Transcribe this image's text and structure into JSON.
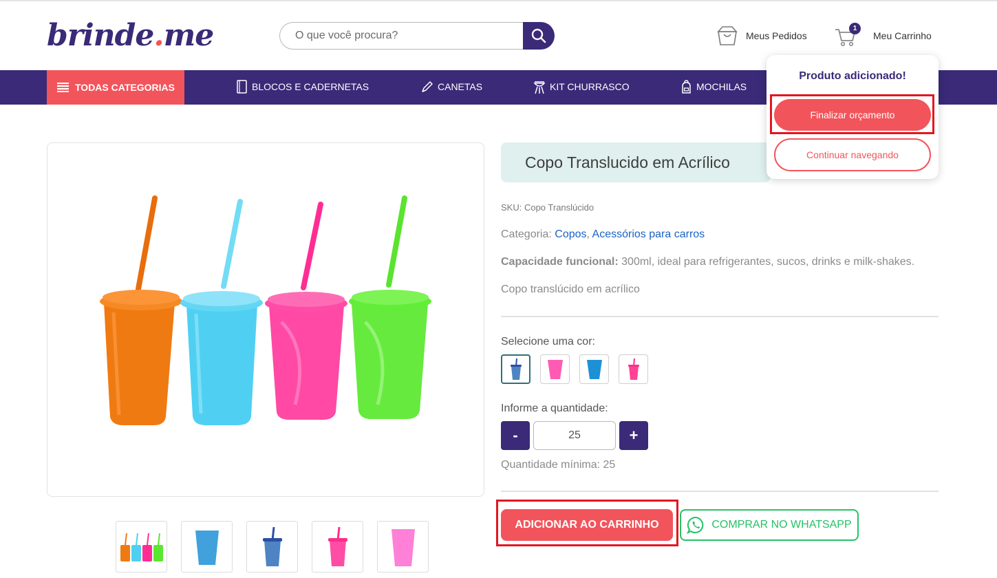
{
  "header": {
    "logo_main": "brinde",
    "logo_dot": ".",
    "logo_tail": "me",
    "search_placeholder": "O que você procura?",
    "orders_label": "Meus Pedidos",
    "cart_label": "Meu Carrinho",
    "cart_count": "1"
  },
  "nav": {
    "all_label": "TODAS CATEGORIAS",
    "items": [
      {
        "label": "BLOCOS E CADERNETAS",
        "icon": "notebook-icon"
      },
      {
        "label": "CANETAS",
        "icon": "pen-icon"
      },
      {
        "label": "KIT CHURRASCO",
        "icon": "grill-icon"
      },
      {
        "label": "MOCHILAS",
        "icon": "backpack-icon"
      }
    ]
  },
  "product": {
    "title": "Copo Translucido em Acrílico",
    "sku": "SKU: Copo Translúcido",
    "category_label": "Categoria:",
    "categories": [
      "Copos",
      "Acessórios para carros"
    ],
    "category_sep": ",",
    "capacity_label": "Capacidade funcional:",
    "capacity_value": " 300ml, ideal para refrigerantes, sucos, drinks e milk-shakes.",
    "description": "Copo translúcido em acrílico",
    "color_label": "Selecione uma cor:",
    "swatches": [
      {
        "color": "#2f6fb8",
        "icon": "cup-with-straw-icon"
      },
      {
        "color": "#ff3ea5",
        "icon": "cup-icon"
      },
      {
        "color": "#1e90d6",
        "icon": "cup-icon"
      },
      {
        "color": "#ff2d8a",
        "icon": "cup-with-straw-icon"
      }
    ],
    "quantity_label": "Informe a quantidade:",
    "quantity_minus": "-",
    "quantity_plus": "+",
    "quantity_value": "25",
    "min_quantity": "Quantidade mínima: 25",
    "add_to_cart": "ADICIONAR AO CARRINHO",
    "whatsapp": "COMPRAR NO WHATSAPP",
    "image_colors": [
      "#f07a12",
      "#4fd0f2",
      "#ff2d93",
      "#59e82e"
    ]
  },
  "popup": {
    "title": "Produto adicionado!",
    "finish": "Finalizar orçamento",
    "continue": "Continuar navegando"
  },
  "colors": {
    "brand_purple": "#3a2a78",
    "accent_coral": "#f2545b",
    "whatsapp_green": "#25c266",
    "highlight_red": "#e3161e"
  }
}
